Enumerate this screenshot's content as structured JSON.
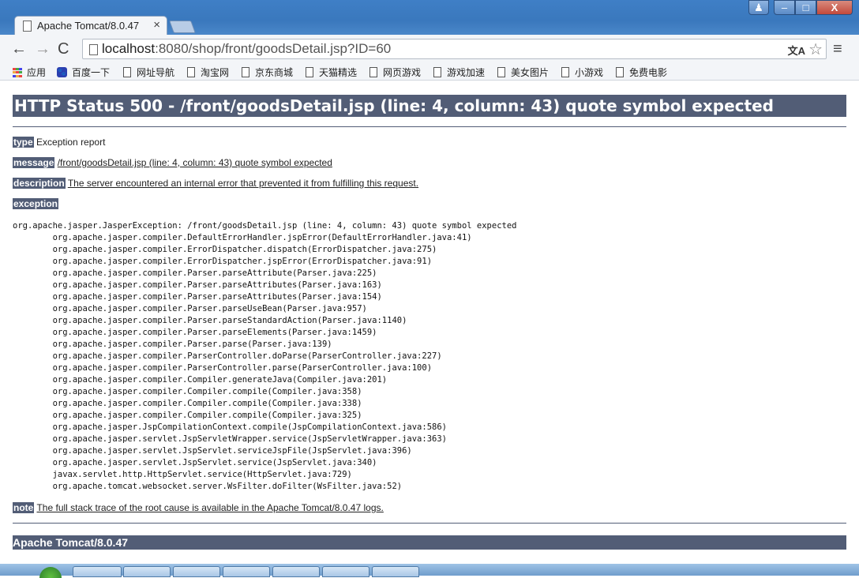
{
  "browser": {
    "tab_title": "Apache Tomcat/8.0.47",
    "tab_close": "×",
    "url_host": "localhost",
    "url_path": ":8080/shop/front/goodsDetail.jsp?ID=60",
    "icons": {
      "back": "←",
      "forward": "→",
      "reload": "C",
      "star": "☆",
      "menu": "≡",
      "translate": "文A"
    }
  },
  "window_controls": {
    "user": "♟",
    "minimize": "–",
    "maximize": "□",
    "close": "X"
  },
  "bookmarks": [
    {
      "label": "应用"
    },
    {
      "label": "百度一下"
    },
    {
      "label": "网址导航"
    },
    {
      "label": "淘宝网"
    },
    {
      "label": "京东商城"
    },
    {
      "label": "天猫精选"
    },
    {
      "label": "网页游戏"
    },
    {
      "label": "游戏加速"
    },
    {
      "label": "美女图片"
    },
    {
      "label": "小游戏"
    },
    {
      "label": "免费电影"
    }
  ],
  "error": {
    "title": "HTTP Status 500 - /front/goodsDetail.jsp (line: 4, column: 43) quote symbol expected",
    "type_label": "type",
    "type_value": "Exception report",
    "message_label": "message",
    "message_value": "/front/goodsDetail.jsp (line: 4, column: 43) quote symbol expected",
    "description_label": "description",
    "description_value": "The server encountered an internal error that prevented it from fulfilling this request.",
    "exception_label": "exception",
    "stack_trace": "org.apache.jasper.JasperException: /front/goodsDetail.jsp (line: 4, column: 43) quote symbol expected\n\torg.apache.jasper.compiler.DefaultErrorHandler.jspError(DefaultErrorHandler.java:41)\n\torg.apache.jasper.compiler.ErrorDispatcher.dispatch(ErrorDispatcher.java:275)\n\torg.apache.jasper.compiler.ErrorDispatcher.jspError(ErrorDispatcher.java:91)\n\torg.apache.jasper.compiler.Parser.parseAttribute(Parser.java:225)\n\torg.apache.jasper.compiler.Parser.parseAttributes(Parser.java:163)\n\torg.apache.jasper.compiler.Parser.parseAttributes(Parser.java:154)\n\torg.apache.jasper.compiler.Parser.parseUseBean(Parser.java:957)\n\torg.apache.jasper.compiler.Parser.parseStandardAction(Parser.java:1140)\n\torg.apache.jasper.compiler.Parser.parseElements(Parser.java:1459)\n\torg.apache.jasper.compiler.Parser.parse(Parser.java:139)\n\torg.apache.jasper.compiler.ParserController.doParse(ParserController.java:227)\n\torg.apache.jasper.compiler.ParserController.parse(ParserController.java:100)\n\torg.apache.jasper.compiler.Compiler.generateJava(Compiler.java:201)\n\torg.apache.jasper.compiler.Compiler.compile(Compiler.java:358)\n\torg.apache.jasper.compiler.Compiler.compile(Compiler.java:338)\n\torg.apache.jasper.compiler.Compiler.compile(Compiler.java:325)\n\torg.apache.jasper.JspCompilationContext.compile(JspCompilationContext.java:586)\n\torg.apache.jasper.servlet.JspServletWrapper.service(JspServletWrapper.java:363)\n\torg.apache.jasper.servlet.JspServlet.serviceJspFile(JspServlet.java:396)\n\torg.apache.jasper.servlet.JspServlet.service(JspServlet.java:340)\n\tjavax.servlet.http.HttpServlet.service(HttpServlet.java:729)\n\torg.apache.tomcat.websocket.server.WsFilter.doFilter(WsFilter.java:52)",
    "note_label": "note",
    "note_value": "The full stack trace of the root cause is available in the Apache Tomcat/8.0.47 logs.",
    "footer": "Apache Tomcat/8.0.47"
  },
  "colors": {
    "tomcat_header": "#525d76",
    "window_frame": "#3f7fc6"
  }
}
